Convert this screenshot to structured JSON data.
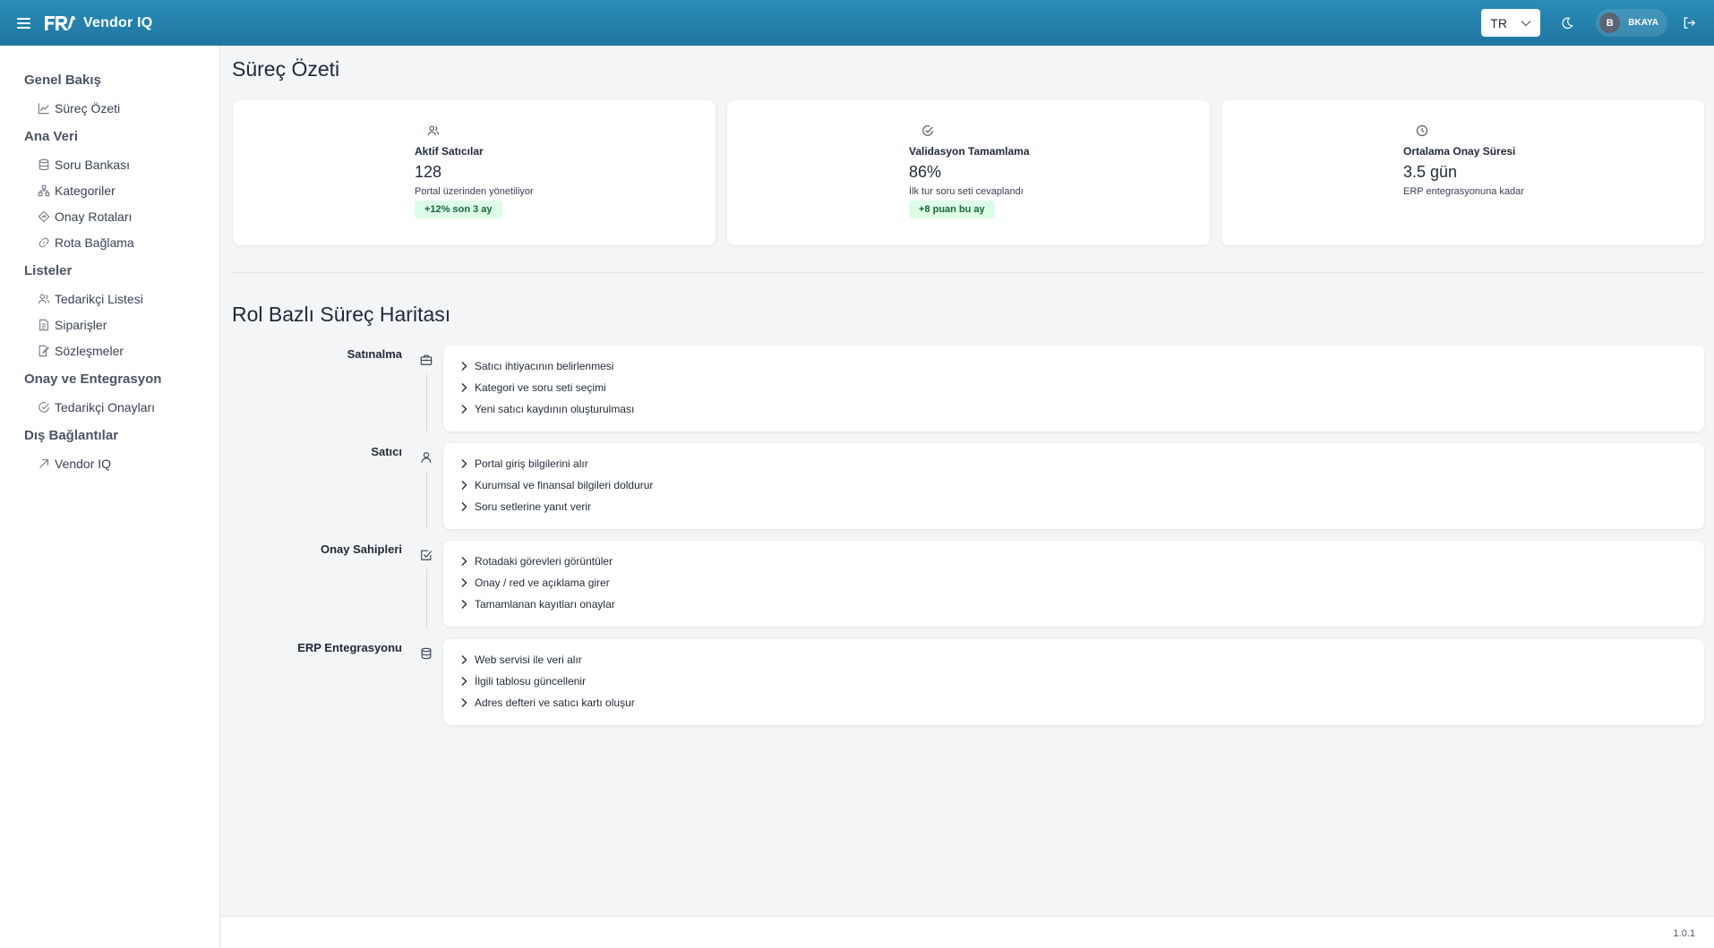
{
  "header": {
    "brand": "Vendor IQ",
    "language": "TR",
    "user_initial": "B",
    "user_name": "BKAYA"
  },
  "sidebar": {
    "groups": [
      {
        "label": "Genel Bakış",
        "items": [
          {
            "label": "Süreç Özeti",
            "icon": "chart-line-icon"
          }
        ]
      },
      {
        "label": "Ana Veri",
        "items": [
          {
            "label": "Soru Bankası",
            "icon": "database-icon"
          },
          {
            "label": "Kategoriler",
            "icon": "hierarchy-icon"
          },
          {
            "label": "Onay Rotaları",
            "icon": "route-icon"
          },
          {
            "label": "Rota Bağlama",
            "icon": "link-icon"
          }
        ]
      },
      {
        "label": "Listeler",
        "items": [
          {
            "label": "Tedarikçi Listesi",
            "icon": "users-icon"
          },
          {
            "label": "Siparişler",
            "icon": "document-icon"
          },
          {
            "label": "Sözleşmeler",
            "icon": "contract-icon"
          }
        ]
      },
      {
        "label": "Onay ve Entegrasyon",
        "items": [
          {
            "label": "Tedarikçi Onayları",
            "icon": "check-circle-icon"
          }
        ]
      },
      {
        "label": "Dış Bağlantılar",
        "items": [
          {
            "label": "Vendor IQ",
            "icon": "external-arrow-icon"
          }
        ]
      }
    ]
  },
  "overview": {
    "title": "Süreç Özeti",
    "kpis": [
      {
        "icon": "users-icon",
        "label": "Aktif Satıcılar",
        "value": "128",
        "sub": "Portal üzerinden yönetiliyor",
        "badge": "+12% son 3 ay"
      },
      {
        "icon": "check-circle-icon",
        "label": "Validasyon Tamamlama",
        "value": "86%",
        "sub": "İlk tur soru seti cevaplandı",
        "badge": "+8 puan bu ay"
      },
      {
        "icon": "clock-icon",
        "label": "Ortalama Onay Süresi",
        "value": "3.5 gün",
        "sub": "ERP entegrasyonuna kadar",
        "badge": ""
      }
    ]
  },
  "process_map": {
    "title": "Rol Bazlı Süreç Haritası",
    "roles": [
      {
        "name": "Satınalma",
        "icon": "briefcase-icon",
        "steps": [
          "Satıcı ihtiyacının belirlenmesi",
          "Kategori ve soru seti seçimi",
          "Yeni satıcı kaydının oluşturulması"
        ]
      },
      {
        "name": "Satıcı",
        "icon": "user-icon",
        "steps": [
          "Portal giriş bilgilerini alır",
          "Kurumsal ve finansal bilgileri doldurur",
          "Soru setlerine yanıt verir"
        ]
      },
      {
        "name": "Onay Sahipleri",
        "icon": "checkbox-icon",
        "steps": [
          "Rotadaki görevleri görüntüler",
          "Onay / red ve açıklama girer",
          "Tamamlanan kayıtları onaylar"
        ]
      },
      {
        "name": "ERP Entegrasyonu",
        "icon": "database-icon",
        "steps": [
          "Web servisi ile veri alır",
          "İlgili tablosu güncellenir",
          "Adres defteri ve satıcı kartı oluşur"
        ]
      }
    ]
  },
  "footer": {
    "version": "1.0.1"
  }
}
